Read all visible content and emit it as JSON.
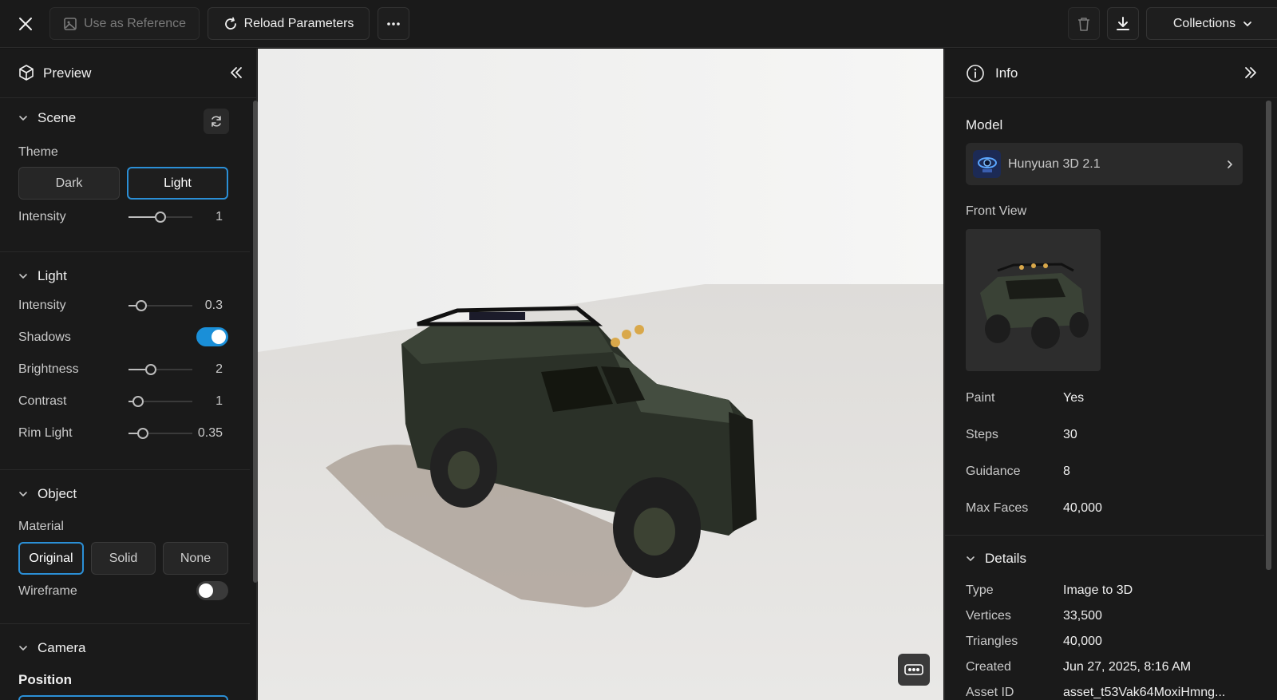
{
  "topbar": {
    "use_as_reference": "Use as Reference",
    "reload_parameters": "Reload Parameters",
    "collections": "Collections"
  },
  "left_panel": {
    "title": "Preview",
    "scene": {
      "heading": "Scene",
      "theme_label": "Theme",
      "theme_options": [
        "Dark",
        "Light"
      ],
      "theme_selected": "Light",
      "intensity_label": "Intensity",
      "intensity_value": "1",
      "intensity_level": 0.5
    },
    "light": {
      "heading": "Light",
      "intensity_label": "Intensity",
      "intensity_value": "0.3",
      "intensity_level": 0.2,
      "shadows_label": "Shadows",
      "shadows_on": true,
      "brightness_label": "Brightness",
      "brightness_value": "2",
      "brightness_level": 0.35,
      "contrast_label": "Contrast",
      "contrast_value": "1",
      "contrast_level": 0.15,
      "rim_light_label": "Rim Light",
      "rim_light_value": "0.35",
      "rim_light_level": 0.22
    },
    "object": {
      "heading": "Object",
      "material_label": "Material",
      "material_options": [
        "Original",
        "Solid",
        "None"
      ],
      "material_selected": "Original",
      "wireframe_label": "Wireframe",
      "wireframe_on": false
    },
    "camera": {
      "heading": "Camera",
      "position_label": "Position"
    }
  },
  "right_panel": {
    "title": "Info",
    "model_label": "Model",
    "model_name": "Hunyuan 3D 2.1",
    "front_view_label": "Front View",
    "params": [
      {
        "label": "Paint",
        "value": "Yes"
      },
      {
        "label": "Steps",
        "value": "30"
      },
      {
        "label": "Guidance",
        "value": "8"
      },
      {
        "label": "Max Faces",
        "value": "40,000"
      }
    ],
    "details_heading": "Details",
    "details": [
      {
        "label": "Type",
        "value": "Image to 3D"
      },
      {
        "label": "Vertices",
        "value": "33,500"
      },
      {
        "label": "Triangles",
        "value": "40,000"
      },
      {
        "label": "Created",
        "value": "Jun 27, 2025, 8:16 AM"
      },
      {
        "label": "Asset ID",
        "value": "asset_t53Vak64MoxiHmng..."
      }
    ]
  },
  "colors": {
    "accent": "#1a8fd8",
    "panel_bg": "#1a1a1a",
    "viewport_bg": "#f3f3f2"
  },
  "icons": [
    "close-icon",
    "image-icon",
    "reload-icon",
    "more-icon",
    "trash-icon",
    "download-icon",
    "chevron-down-icon",
    "cube-icon",
    "collapse-left-icon",
    "refresh-icon",
    "info-icon",
    "collapse-right-icon",
    "chevron-right-icon",
    "controls-icon"
  ]
}
